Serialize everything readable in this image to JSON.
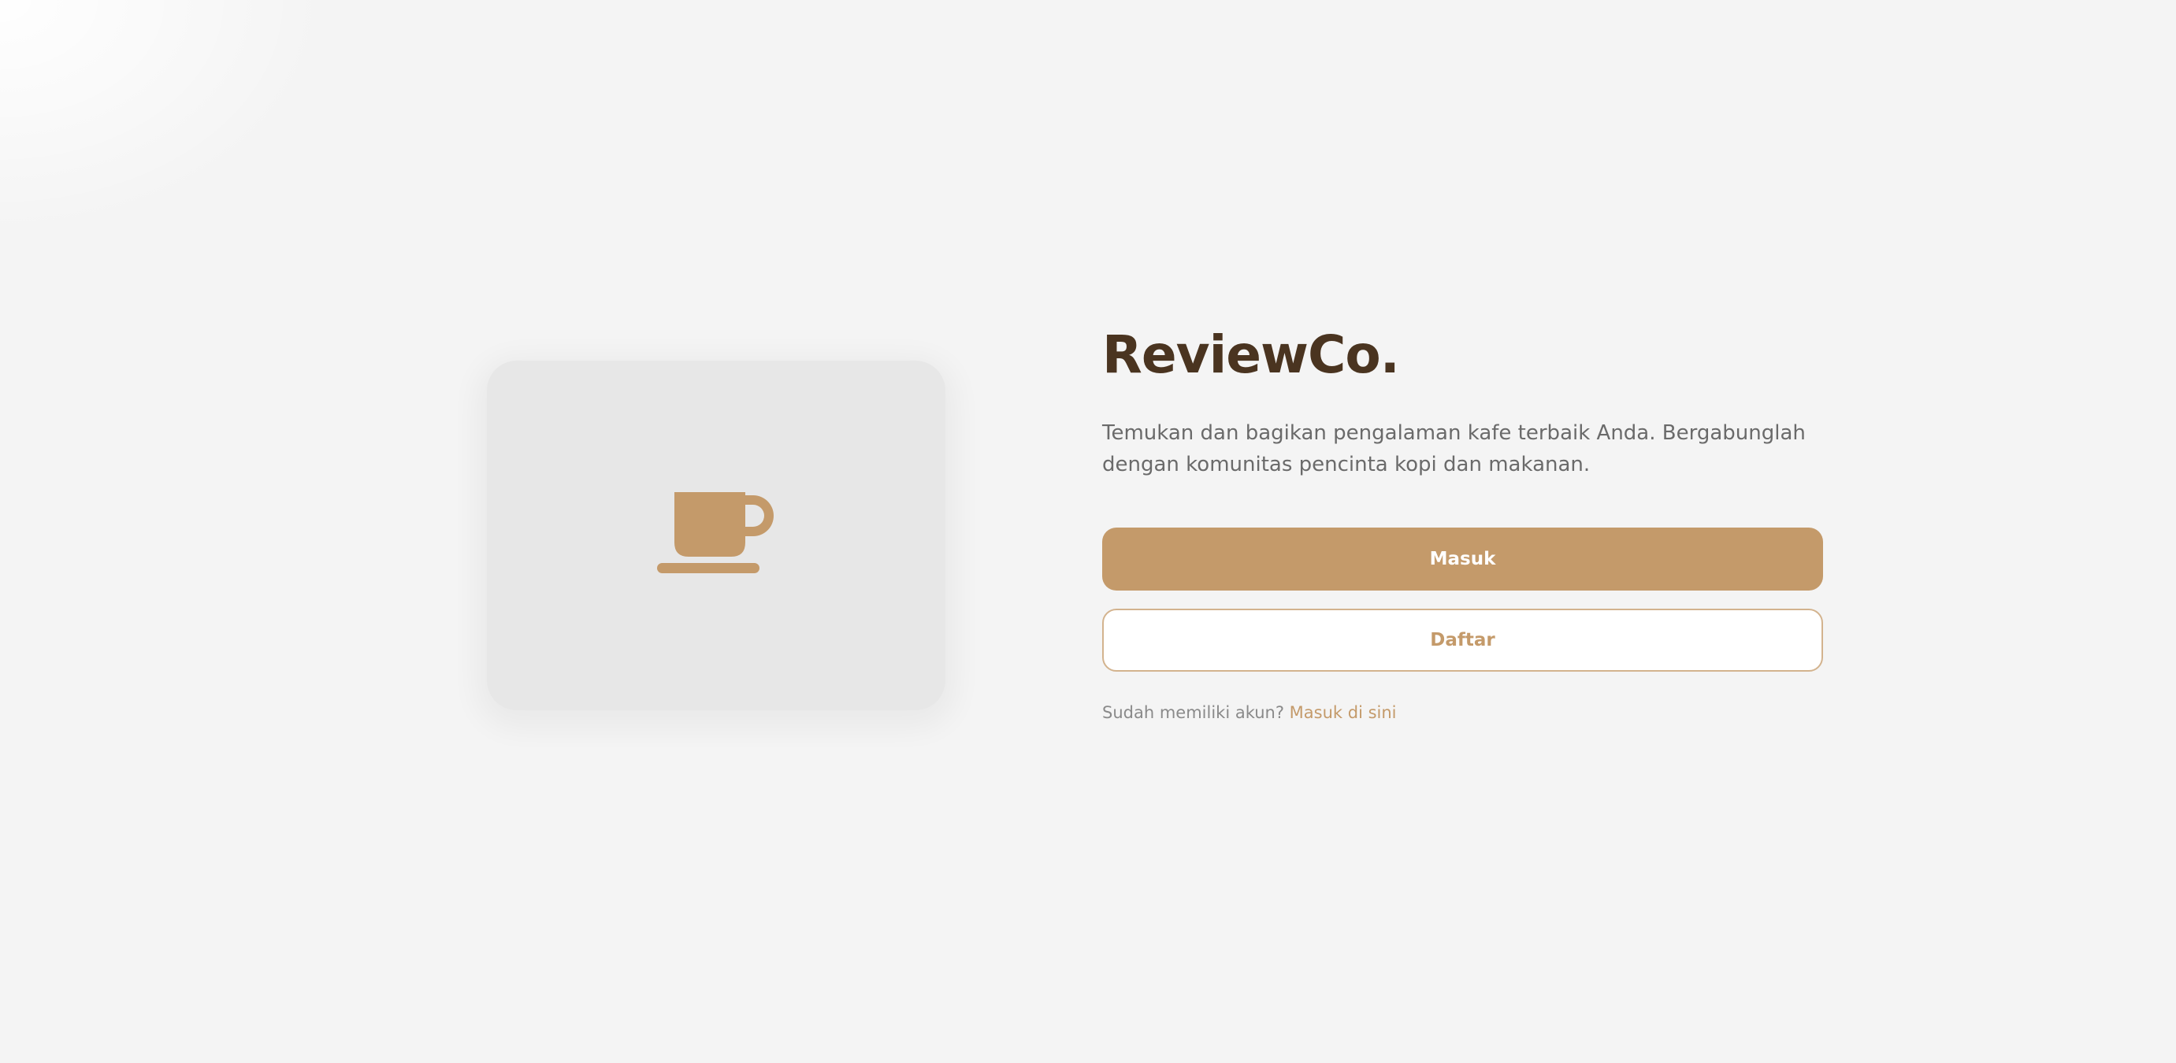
{
  "brand": {
    "title": "ReviewCo.",
    "description": "Temukan dan bagikan pengalaman kafe terbaik Anda. Bergabunglah dengan komunitas pencinta kopi dan makanan."
  },
  "hero": {
    "icon": "coffee-cup-icon"
  },
  "actions": {
    "login_label": "Masuk",
    "register_label": "Daftar"
  },
  "footer_hint": {
    "text": "Sudah memiliki akun?",
    "link_label": "Masuk di sini"
  },
  "colors": {
    "accent": "#c49a6a",
    "title": "#4a3420",
    "background": "#f4f4f4",
    "card": "#e7e7e7"
  }
}
